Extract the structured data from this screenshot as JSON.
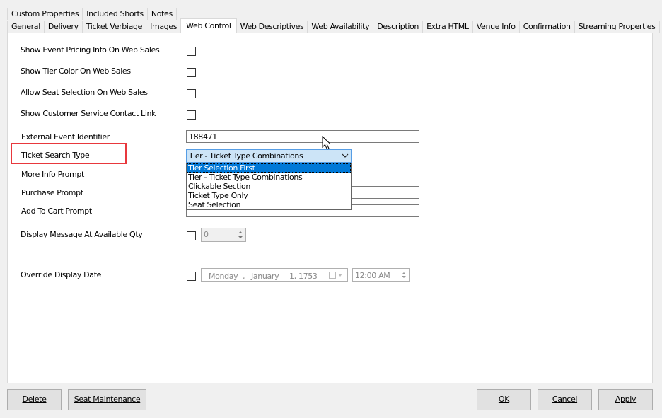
{
  "tabs_row1": [
    "Custom Properties",
    "Included Shorts",
    "Notes"
  ],
  "tabs_row2": [
    "General",
    "Delivery",
    "Ticket Verbiage",
    "Images",
    "Web Control",
    "Web Descriptives",
    "Web Availability",
    "Description",
    "Extra HTML",
    "Venue Info",
    "Confirmation",
    "Streaming Properties"
  ],
  "active_tab": "Web Control",
  "form": {
    "show_event_pricing": "Show Event Pricing Info On Web Sales",
    "show_tier_color": "Show Tier Color On Web Sales",
    "allow_seat_selection": "Allow Seat Selection On Web Sales",
    "show_customer_service": "Show Customer Service Contact Link",
    "external_event_identifier": {
      "label": "External Event Identifier",
      "value": "188471"
    },
    "ticket_search_type": {
      "label": "Ticket Search Type",
      "value": "Tier - Ticket Type Combinations",
      "options": [
        "Tier Selection First",
        "Tier - Ticket Type Combinations",
        "Clickable Section",
        "Ticket Type Only",
        "Seat Selection"
      ],
      "highlighted": "Tier Selection First"
    },
    "more_info_prompt": "More Info Prompt",
    "purchase_prompt": "Purchase Prompt",
    "add_to_cart_prompt": "Add To Cart Prompt",
    "display_message": {
      "label": "Display Message At Available Qty",
      "value": "0"
    },
    "override_display_date": {
      "label": "Override Display Date",
      "weekday": "Monday",
      "comma": ",",
      "month": "January",
      "day_year": "1, 1753",
      "time": "12:00 AM"
    }
  },
  "buttons": {
    "delete": "Delete",
    "seat_maintenance": "Seat Maintenance",
    "ok": "OK",
    "cancel": "Cancel",
    "apply": "Apply"
  },
  "colors": {
    "highlight_box": "#e8383d",
    "selection": "#0078d7"
  }
}
